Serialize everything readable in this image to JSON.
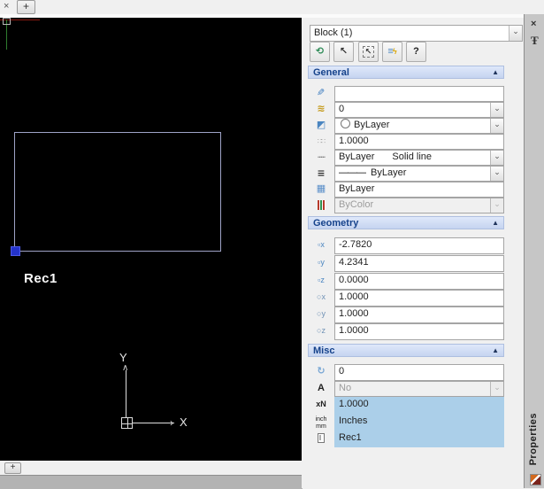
{
  "tab_bar": {
    "close_label": "×",
    "new_tab_label": "+"
  },
  "canvas": {
    "shape_label": "Rec1",
    "axis_x_label": "X",
    "axis_y_label": "Y",
    "colors": {
      "background": "#000000",
      "rect_stroke": "#9fa3c7",
      "grip_blue": "#2433cb",
      "ucs_red": "#8a1a12",
      "ucs_green": "#2f7d2f"
    }
  },
  "bottom_bar": {
    "add_label": "+"
  },
  "panel": {
    "selector_value": "Block (1)",
    "collapse_arrow": "▲",
    "toolbar": {
      "help_label": "?"
    },
    "colors": {
      "section_header_bg": "#cdd9f2",
      "section_header_text": "#15428b",
      "highlight_row_bg": "#abcfe9",
      "panel_bg": "#f0f0f0"
    },
    "general": {
      "title": "General",
      "rows": [
        {
          "icon": "pen-icon",
          "value": ""
        },
        {
          "icon": "layers-icon",
          "value": "0"
        },
        {
          "icon": "color-icon",
          "value": "ByLayer"
        },
        {
          "icon": "linetype-scale-icon",
          "value": "1.0000"
        },
        {
          "icon": "linetype-icon",
          "value": "ByLayer",
          "value2": "Solid line"
        },
        {
          "icon": "lineweight-icon",
          "prefix": "———",
          "value": "ByLayer"
        },
        {
          "icon": "transparency-icon",
          "value": "ByLayer"
        },
        {
          "icon": "plot-style-icon",
          "value": "ByColor"
        }
      ]
    },
    "geometry": {
      "title": "Geometry",
      "rows": [
        {
          "icon": "position-x-icon",
          "value": "-2.7820"
        },
        {
          "icon": "position-y-icon",
          "value": "4.2341"
        },
        {
          "icon": "position-z-icon",
          "value": "0.0000"
        },
        {
          "icon": "scale-x-icon",
          "value": "1.0000"
        },
        {
          "icon": "scale-y-icon",
          "value": "1.0000"
        },
        {
          "icon": "scale-z-icon",
          "value": "1.0000"
        }
      ]
    },
    "misc": {
      "title": "Misc",
      "rows": [
        {
          "icon": "rotation-icon",
          "value": "0"
        },
        {
          "icon": "annotative-icon",
          "value": "No"
        },
        {
          "icon": "unit-factor-icon",
          "value": "1.0000"
        },
        {
          "icon": "units-icon",
          "value": "Inches"
        },
        {
          "icon": "block-name-icon",
          "value": "Rec1"
        }
      ]
    }
  },
  "side_tab": {
    "close_label": "×",
    "title": "Properties"
  },
  "icons": {
    "quick-select-icon": "⟲",
    "select-objects-icon": "↖",
    "toggle-pickadd-icon": "⬚↖",
    "quick-properties-icon": "≡ϟ",
    "help-icon": "?",
    "pen-icon": "✎",
    "layers-icon": "≋",
    "color-icon": "◩",
    "linetype-scale-icon": "∷",
    "linetype-icon": "┅",
    "lineweight-icon": "≡",
    "transparency-icon": "▦",
    "plot-style-icon": "stripes",
    "position-x-icon": "▫x",
    "position-y-icon": "▫y",
    "position-z-icon": "▫z",
    "scale-x-icon": "○x",
    "scale-y-icon": "○y",
    "scale-z-icon": "○z",
    "rotation-icon": "↻",
    "annotative-icon": "A",
    "unit-factor-icon": "xN",
    "units-icon": "inch/mm",
    "block-name-icon": "I",
    "pin-icon": "Ŧ",
    "dropdown-chevron-icon": "⌄"
  }
}
